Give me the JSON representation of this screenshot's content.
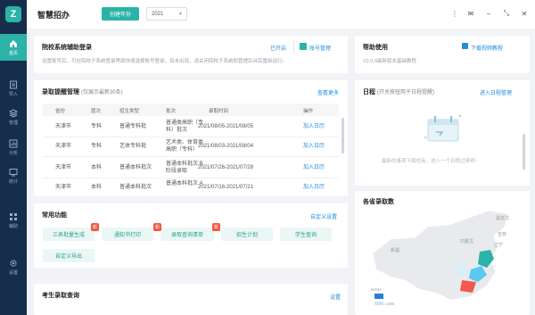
{
  "app": {
    "logo_glyph": "Z",
    "title": "智慧招办",
    "create_button": "创建年份",
    "year": "2021"
  },
  "sidebar": [
    {
      "label": "首页",
      "icon": "home-icon",
      "active": true
    },
    {
      "label": "导入",
      "icon": "import-icon"
    },
    {
      "label": "管理",
      "icon": "stack-icon"
    },
    {
      "label": "分析",
      "icon": "chart-icon"
    },
    {
      "label": "统计",
      "icon": "stats-icon"
    },
    {
      "label": "辅助",
      "icon": "grid-icon"
    },
    {
      "label": "设置",
      "icon": "gear-icon"
    }
  ],
  "login_card": {
    "title": "院校系统辅助登录",
    "status": "已开启",
    "account_link": "账号管理",
    "description": "设置账号后，可在院校子系统登录界面快速选择账号登录。如未出现，请关闭院校子系统和管理后台后重新运行。"
  },
  "help_card": {
    "title": "帮助使用",
    "download_link": "下载视频教程",
    "version_text": "V2.0.0最新版本基础教程"
  },
  "admission_card": {
    "title": "录取提醒管理",
    "subtitle": "(仅展示最新30条)",
    "view_more": "查看更多",
    "columns": [
      "省份",
      "层次",
      "招生类型",
      "批次",
      "录取时间",
      "操作"
    ],
    "rows": [
      {
        "province": "天津市",
        "level": "专科",
        "type": "普通专科批",
        "batch": [
          "普通类高职（专",
          "科）批次"
        ],
        "time": "2021/08/05-2021/08/05",
        "action": "加入日历"
      },
      {
        "province": "天津市",
        "level": "专科",
        "type": "艺体专科批",
        "batch": [
          "艺术类、体育类",
          "高职（专科）"
        ],
        "time": "2021/08/03-2021/08/04",
        "action": "加入日历"
      },
      {
        "province": "天津市",
        "level": "本科",
        "type": "普通本科批次",
        "batch": [
          "普通本科批次 B",
          "阶段录取"
        ],
        "time": "2021/07/26-2021/07/28",
        "action": "加入日历"
      },
      {
        "province": "天津市",
        "level": "本科",
        "type": "普通本科批次",
        "batch": [
          "普通本科批次 A",
          ""
        ],
        "time": "2021/07/16-2021/07/21",
        "action": "加入日历"
      }
    ]
  },
  "schedule_card": {
    "title": "日程",
    "subtitle": "(开关按钮用于日程提醒)",
    "add_link": "进入日程管理",
    "empty_text": "最新的事项下面也有，进入一个日程过来吧~"
  },
  "functions_card": {
    "title": "常用功能",
    "custom_link": "自定义设置",
    "buttons": [
      "三表批量生成",
      "通知书打印",
      "录取查询清单",
      "招生计划",
      "学生查询"
    ],
    "badge_glyph": "新",
    "custom_export": "自定义导出"
  },
  "province_card": {
    "title": "各省录取数"
  },
  "query_card": {
    "title": "考生录取查询",
    "settings_link": "设置"
  },
  "map_labels": [
    "黑龙江",
    "吉林",
    "辽宁",
    "内蒙古",
    "新疆",
    "HIGH",
    "LOW"
  ],
  "colors": {
    "sidebar": "#172d4c",
    "accent": "#2ab3a6",
    "link": "#1f8de0",
    "badge": "#f4563f"
  }
}
